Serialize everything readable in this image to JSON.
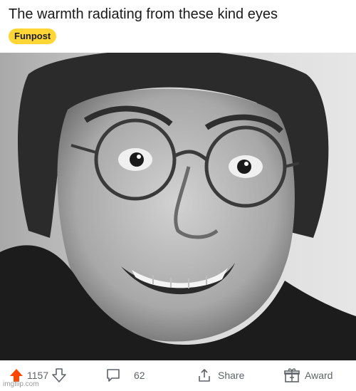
{
  "post": {
    "title": "The warmth radiating from these kind eyes",
    "flair": "Funpost",
    "image_alt": "black and white photo of a man in round glasses with a wide toothy grin"
  },
  "actions": {
    "upvote_count": "1157",
    "comments_count": "62",
    "share_label": "Share",
    "award_label": "Award"
  },
  "colors": {
    "upvote": "#ff4500",
    "flair_bg": "#ffd635",
    "icon_gray": "#5f6368"
  },
  "icons": [
    "upvote-icon",
    "downvote-icon",
    "comment-icon",
    "share-icon",
    "award-icon"
  ],
  "watermark": "imgflip.com"
}
